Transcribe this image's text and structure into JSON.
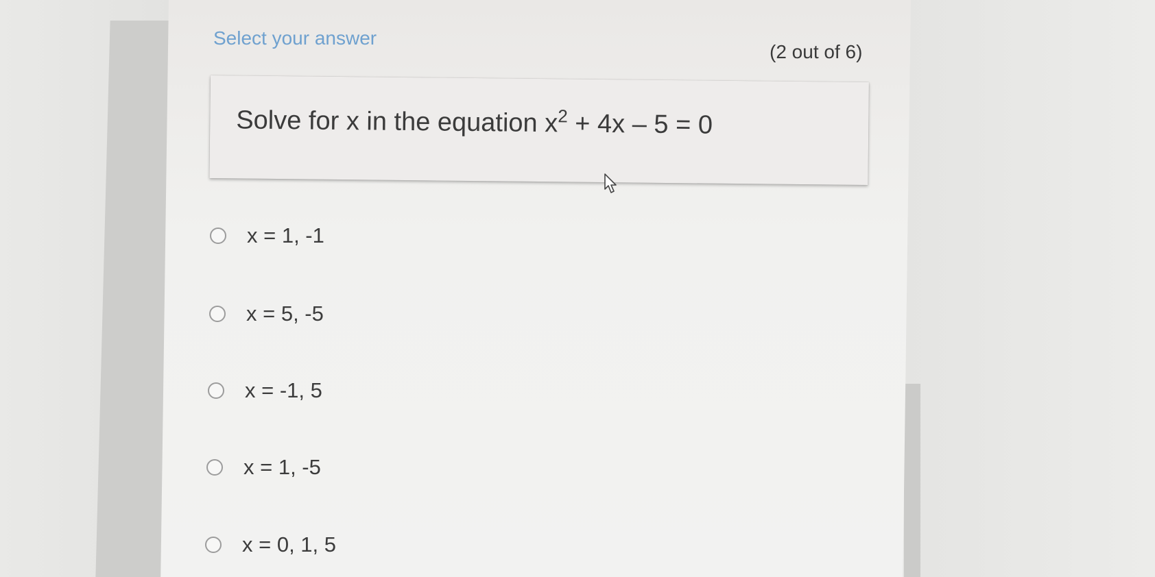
{
  "header": {
    "title": "Select your answer",
    "progress": "(2 out of 6)"
  },
  "question": {
    "prefix": "Solve for x in the equation x",
    "exponent": "2",
    "suffix": " + 4x – 5 = 0"
  },
  "options": [
    {
      "label": "x = 1, -1",
      "selected": false
    },
    {
      "label": "x = 5, -5",
      "selected": false
    },
    {
      "label": "x = -1, 5",
      "selected": false
    },
    {
      "label": "x = 1, -5",
      "selected": false
    },
    {
      "label": "x = 0, 1, 5",
      "selected": false
    }
  ],
  "colors": {
    "accent": "#6fa1cf",
    "text": "#3c3c3c",
    "radio_border": "#9c9c9c"
  },
  "icons": {
    "pointer": "mouse-pointer-icon"
  }
}
